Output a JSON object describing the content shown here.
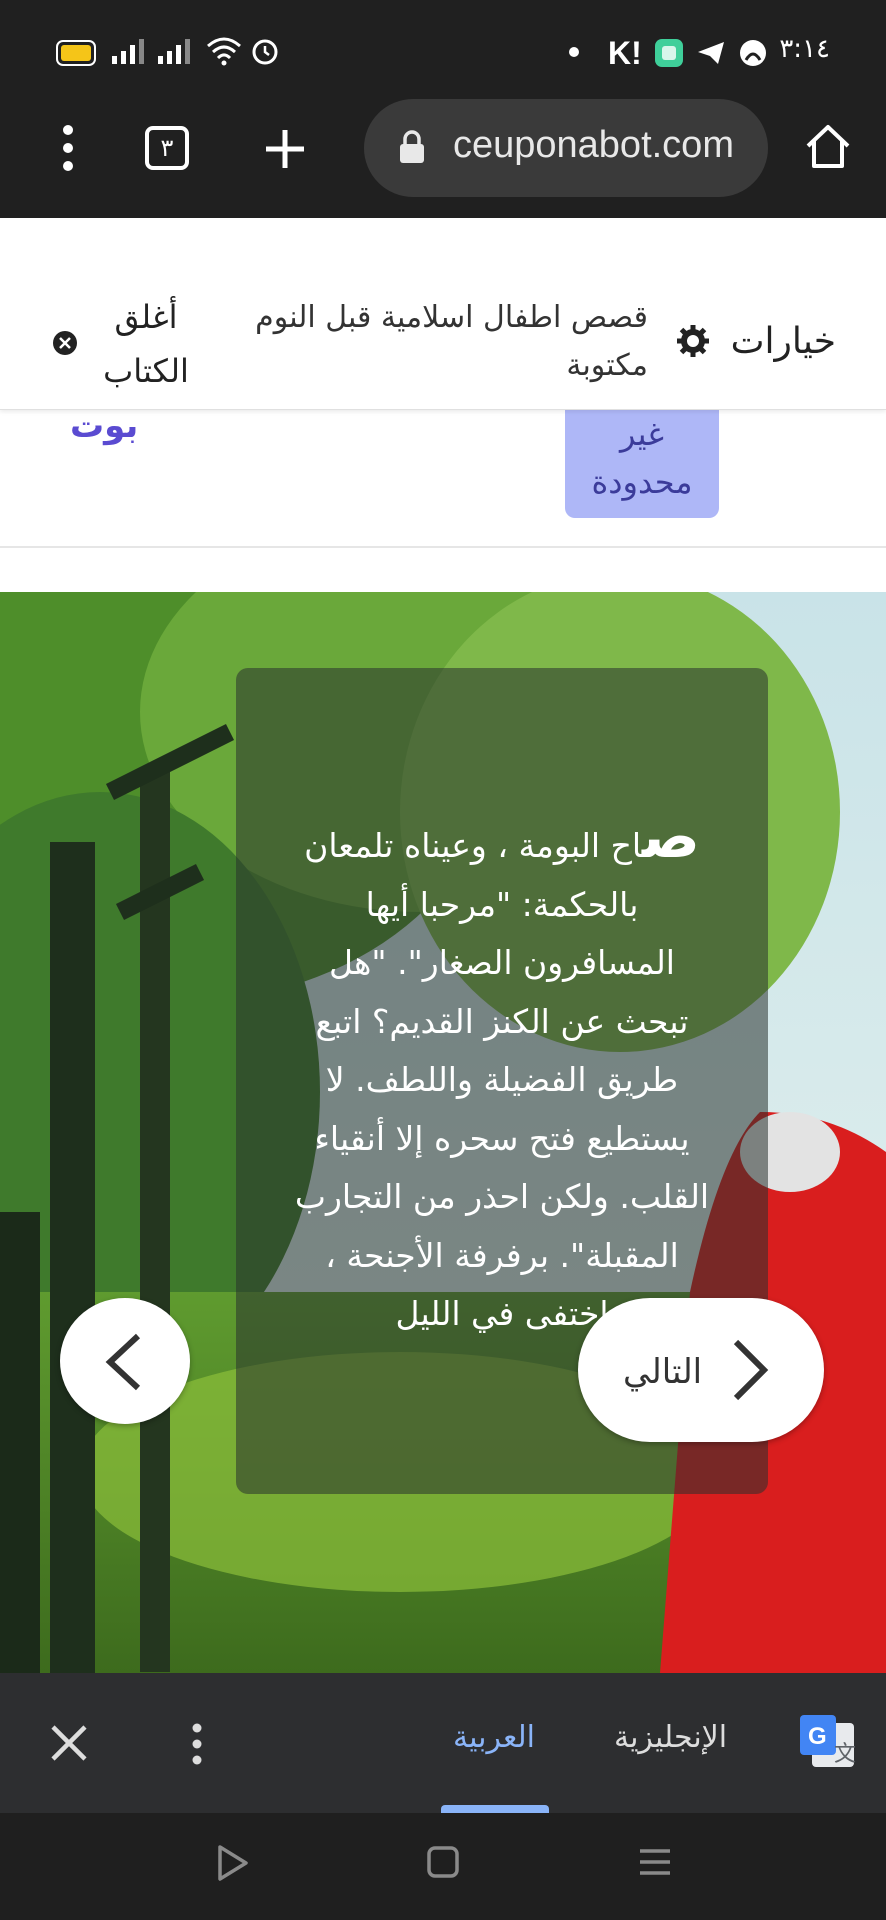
{
  "status_bar": {
    "time": "٣:١٤",
    "icons": [
      "battery-icon",
      "signal-icon",
      "signal-icon",
      "wifi-icon",
      "alarm-icon",
      "dot-icon",
      "k-app-icon",
      "green-app-icon",
      "telegram-icon",
      "xbox-icon"
    ]
  },
  "browser": {
    "tab_count": "٣",
    "url": "ceuponabot.com",
    "icons": [
      "more-vert-icon",
      "tabs-icon",
      "new-tab-icon",
      "lock-icon",
      "home-icon"
    ]
  },
  "reader_bar": {
    "options_label": "خيارات",
    "story_title": "قصص اطفال اسلامية قبل النوم مكتوبة",
    "close_book_label": "أغلق الكتاب"
  },
  "page": {
    "pill_text": "غير محدودة",
    "bot_link": "بوت"
  },
  "story": {
    "dropcap": "ص",
    "text": "اح البومة ، وعيناه تلمعان بالحكمة: \"مرحبا أيها المسافرون الصغار\". \"هل تبحث عن الكنز القديم؟ اتبع طريق الفضيلة واللطف. لا يستطيع فتح سحره إلا أنقياء القلب. ولكن احذر من التجارب المقبلة\". برفرفة الأجنحة ، اختفى في الليل",
    "next_label": "التالي"
  },
  "translate_bar": {
    "languages": [
      "الإنجليزية",
      "العربية"
    ],
    "selected": "العربية"
  },
  "colors": {
    "accent": "#8ab4f8",
    "pill_bg": "#aeb7f7",
    "link": "#5a4bd1"
  }
}
